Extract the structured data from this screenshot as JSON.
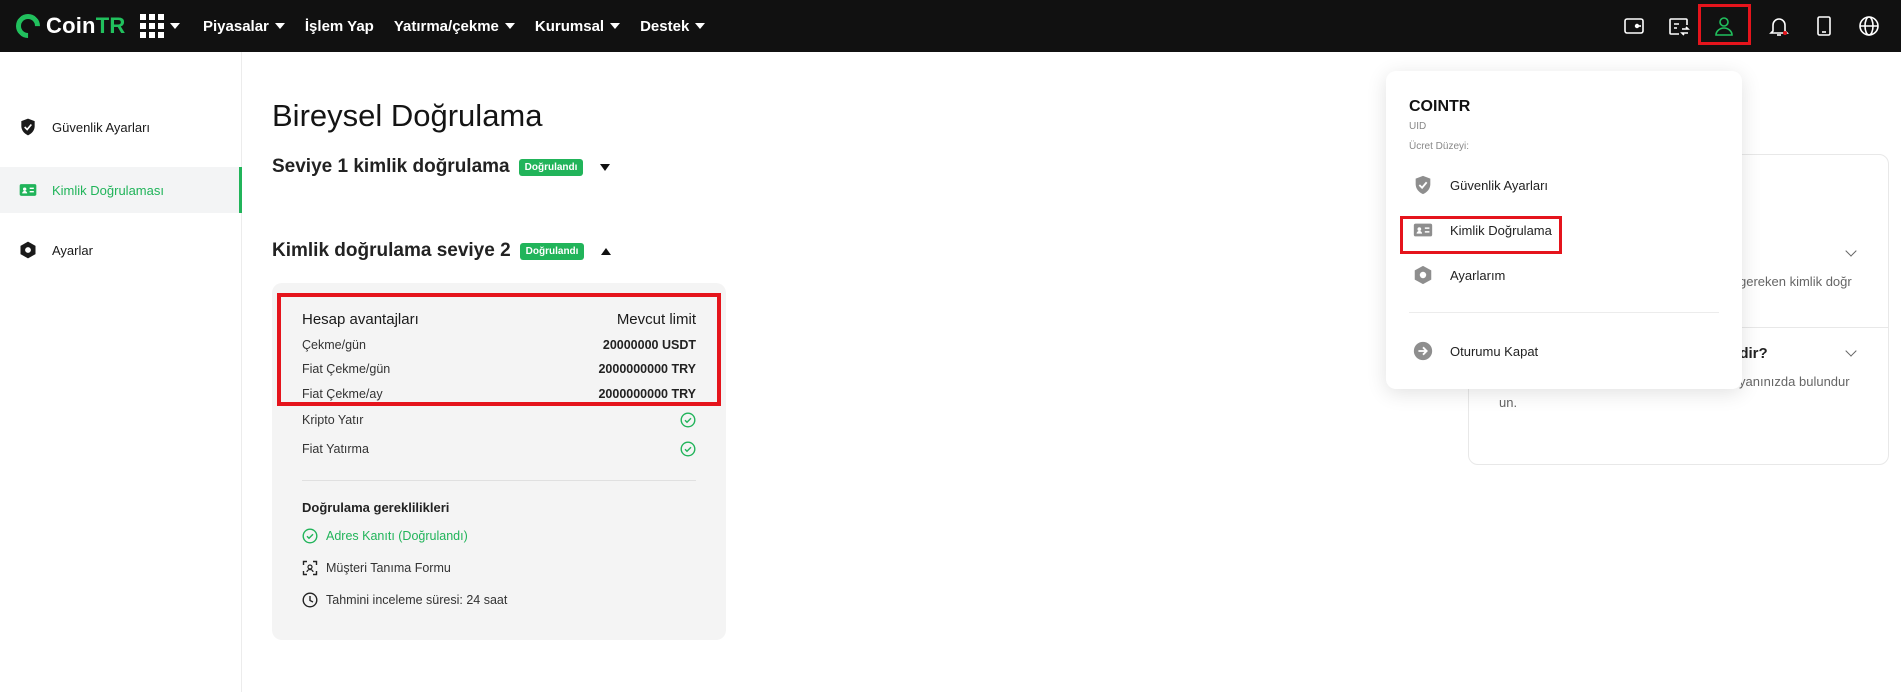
{
  "brand": {
    "name_main": "Coin",
    "name_accent": "TR",
    "accent_color": "#21c05d"
  },
  "nav": {
    "items": [
      "Piyasalar",
      "İşlem Yap",
      "Yatırma/çekme",
      "Kurumsal",
      "Destek"
    ],
    "icons": [
      "wallet-icon",
      "exchange-card-icon",
      "user-icon",
      "bell-icon",
      "tablet-icon",
      "globe-icon"
    ]
  },
  "sidebar": {
    "items": [
      {
        "label": "Güvenlik Ayarları",
        "icon": "shield-check-icon"
      },
      {
        "label": "Kimlik Doğrulaması",
        "icon": "id-card-icon"
      },
      {
        "label": "Ayarlar",
        "icon": "hexagon-gear-icon"
      }
    ]
  },
  "main": {
    "title": "Bireysel Doğrulama",
    "level1": {
      "title": "Seviye 1 kimlik doğrulama",
      "badge": "Doğrulandı"
    },
    "level2": {
      "title": "Kimlik doğrulama seviye 2",
      "badge": "Doğrulandı"
    }
  },
  "benefits": {
    "header_left": "Hesap avantajları",
    "header_right": "Mevcut limit",
    "rows": [
      {
        "label": "Çekme/gün",
        "value": "20000000 USDT"
      },
      {
        "label": "Fiat Çekme/gün",
        "value": "2000000000 TRY"
      },
      {
        "label": "Fiat Çekme/ay",
        "value": "2000000000 TRY"
      }
    ],
    "checks": [
      "Kripto Yatır",
      "Fiat Yatırma"
    ]
  },
  "requirements": {
    "title": "Doğrulama gereklilikleri",
    "items": [
      "Adres Kanıtı (Doğrulandı)",
      "Müşteri Tanıma Formu",
      "Tahmini inceleme süresi: 24 saat"
    ]
  },
  "faq_fragments": {
    "line1": "gereken kimlik doğr",
    "title2": "lidir?",
    "line2a": "yanınızda bulundur",
    "line2b": "un."
  },
  "user_menu": {
    "name": "COINTR",
    "uid_label": "UID",
    "fee_label": "Ücret Düzeyi:",
    "items": [
      "Güvenlik Ayarları",
      "Kimlik Doğrulama",
      "Ayarlarım"
    ],
    "logout": "Oturumu Kapat"
  },
  "colors": {
    "green": "#21b45a",
    "highlight_red": "#e5141c",
    "topbar": "#111111"
  }
}
